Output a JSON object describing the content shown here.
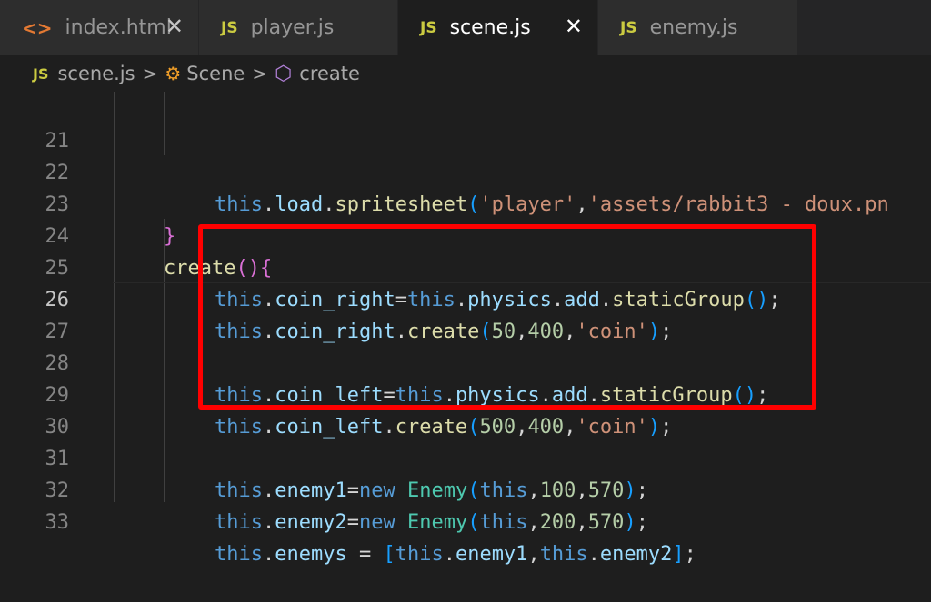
{
  "tabs": [
    {
      "icon": "<>",
      "label": "index.html",
      "close": "✕"
    },
    {
      "icon": "JS",
      "label": "player.js"
    },
    {
      "icon": "JS",
      "label": "scene.js",
      "close": "✕"
    },
    {
      "icon": "JS",
      "label": "enemy.js"
    }
  ],
  "breadcrumb": {
    "file_icon": "JS",
    "file": "scene.js",
    "class": "Scene",
    "method": "create",
    "separator": ">"
  },
  "editor": {
    "line_numbers": [
      "21",
      "22",
      "23",
      "24",
      "25",
      "26",
      "27",
      "28",
      "29",
      "30",
      "31",
      "32",
      "33"
    ],
    "current_line": "26",
    "tokens": {
      "this": "this",
      "dot": ".",
      "load": "load",
      "spritesheet": "spritesheet",
      "lp": "(",
      "rp": ")",
      "str_player": "'player'",
      "comma": ",",
      "str_asset": "'assets/rabbit3 - doux.pn",
      "rbrace": "}",
      "create": "create",
      "lbrace": "{",
      "coin_right": "coin_right",
      "coin_left": "coin_left",
      "eq": "=",
      "physics": "physics",
      "add": "add",
      "staticGroup": "staticGroup",
      "semi": ";",
      "n50": "50",
      "n400": "400",
      "n500": "500",
      "n100": "100",
      "n200": "200",
      "n570": "570",
      "str_coin": "'coin'",
      "enemy1": "enemy1",
      "enemy2": "enemy2",
      "enemys": "enemys",
      "new": "new",
      "Enemy": "Enemy",
      "assign_sp": " = ",
      "lbr": "[",
      "rbr": "]"
    }
  },
  "colors": {
    "highlight_box": "#ff0000",
    "js_icon": "#cbcb41"
  }
}
